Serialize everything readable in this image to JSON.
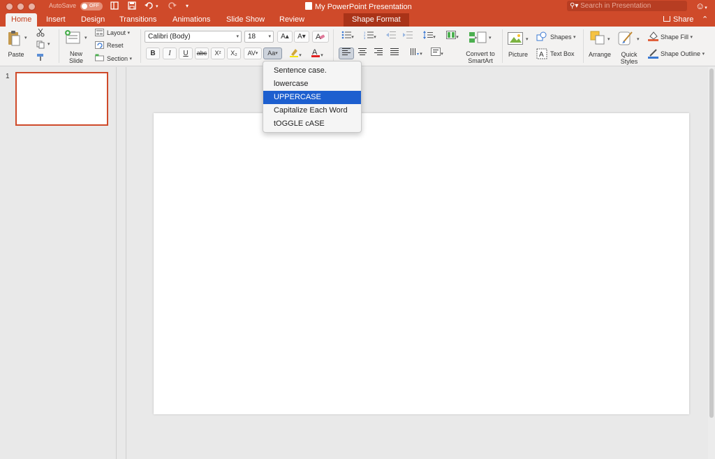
{
  "window": {
    "title": "My PowerPoint Presentation",
    "autosave_label": "AutoSave",
    "autosave_state": "OFF",
    "search_placeholder": "Search in Presentation"
  },
  "tabs": [
    "Home",
    "Insert",
    "Design",
    "Transitions",
    "Animations",
    "Slide Show",
    "Review",
    "Shape Format"
  ],
  "active_tab": "Home",
  "share_label": "Share",
  "ribbon": {
    "paste": "Paste",
    "new_slide_line1": "New",
    "new_slide_line2": "Slide",
    "layout": "Layout",
    "reset": "Reset",
    "section": "Section",
    "font_name": "Calibri (Body)",
    "font_size": "18",
    "bold": "B",
    "italic": "I",
    "underline": "U",
    "strikethrough": "abc",
    "superscript": "X²",
    "subscript": "X₂",
    "char_spacing": "AV",
    "change_case": "Aa",
    "grow_font": "A▴",
    "shrink_font": "A▾",
    "convert_smartart_line1": "Convert to",
    "convert_smartart_line2": "SmartArt",
    "picture": "Picture",
    "shapes": "Shapes",
    "text_box": "Text Box",
    "arrange": "Arrange",
    "quick_styles_line1": "Quick",
    "quick_styles_line2": "Styles",
    "shape_fill": "Shape Fill",
    "shape_outline": "Shape Outline"
  },
  "case_menu": {
    "items": [
      "Sentence case.",
      "lowercase",
      "UPPERCASE",
      "Capitalize Each Word",
      "tOGGLE cASE"
    ],
    "selected": "UPPERCASE"
  },
  "slides_panel": {
    "slide_number": "1"
  },
  "colors": {
    "brand": "#cf4a2a",
    "menu_highlight": "#1d5fcf"
  }
}
